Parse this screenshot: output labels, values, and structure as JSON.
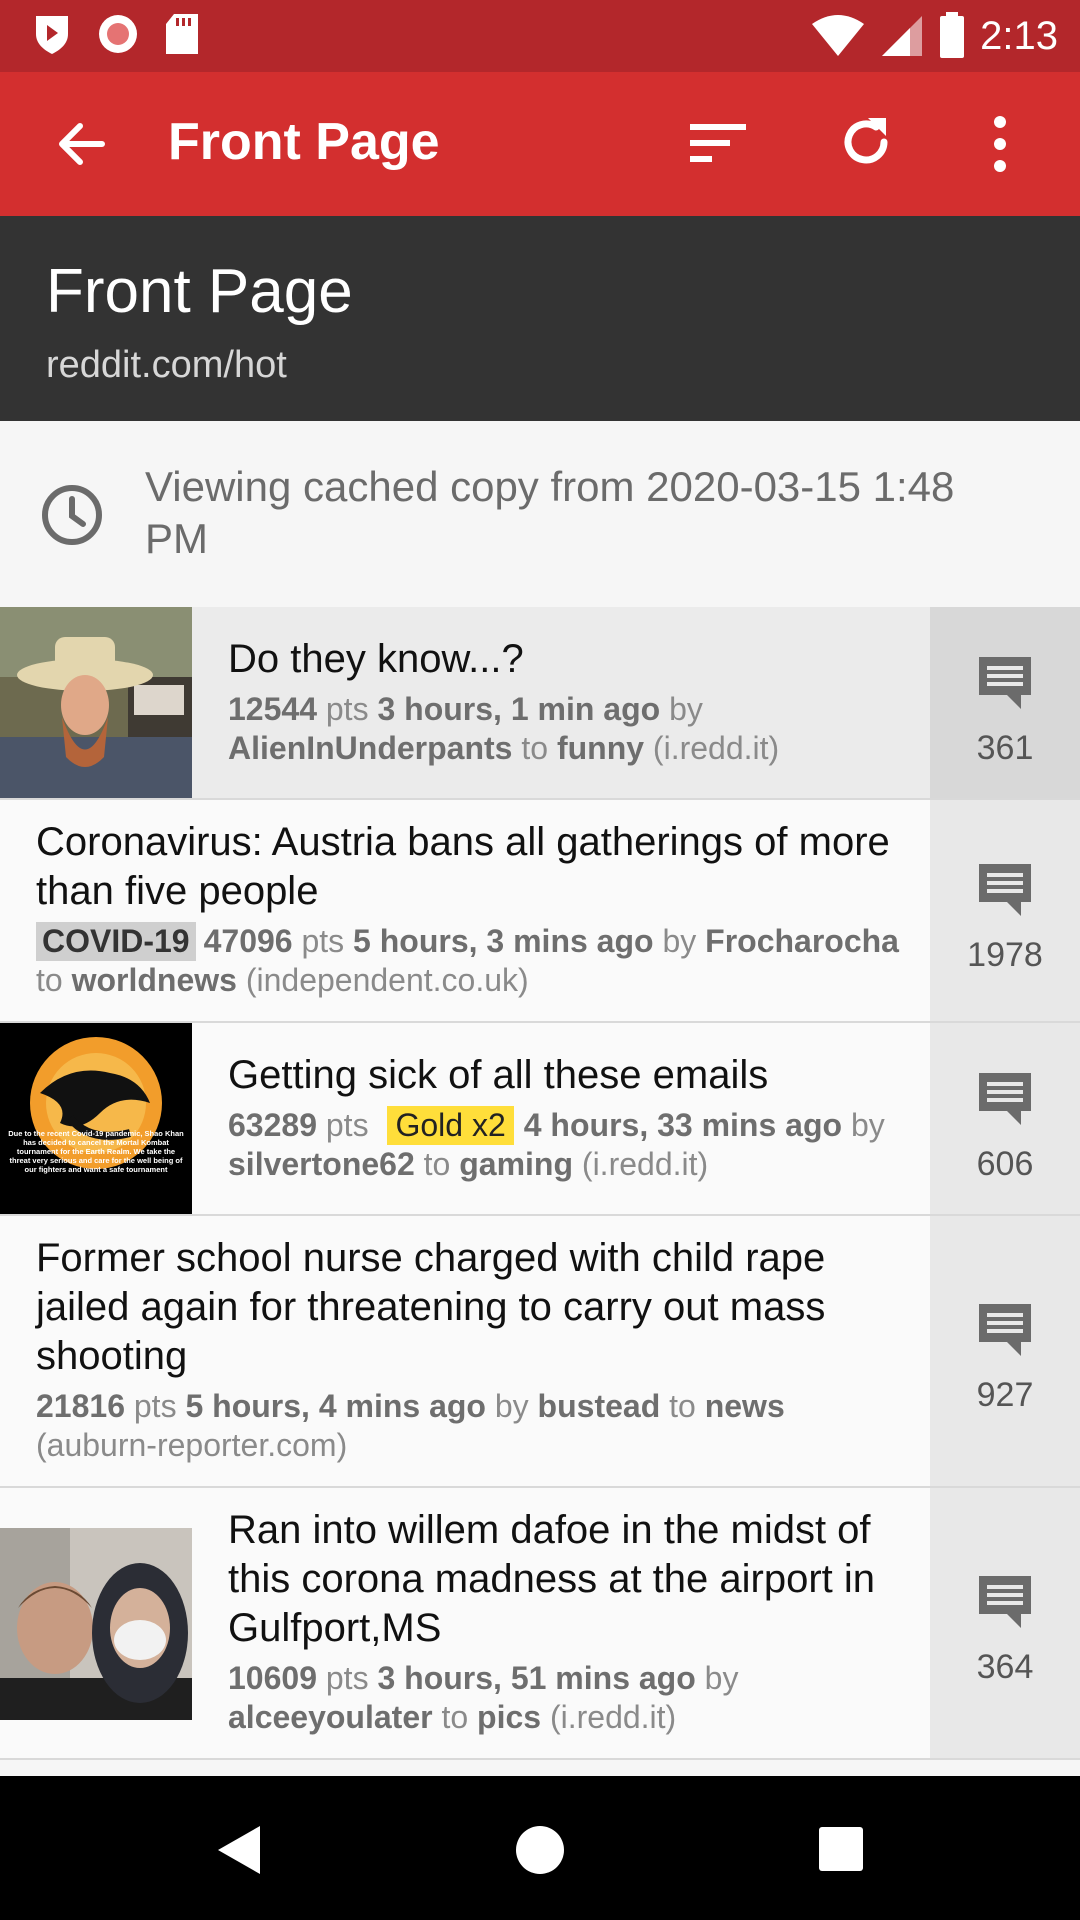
{
  "status": {
    "time": "2:13"
  },
  "toolbar": {
    "title": "Front Page"
  },
  "header": {
    "title": "Front Page",
    "subtitle": "reddit.com/hot"
  },
  "cache_notice": {
    "text": "Viewing cached copy from 2020-03-15 1:48 PM"
  },
  "posts": [
    {
      "title": "Do they know...?",
      "pts": "12544",
      "pts_label": "pts",
      "age": "3 hours, 1 min ago",
      "by": "by",
      "author": "AlienInUnderpants",
      "to": "to",
      "subreddit": "funny",
      "domain": "(i.redd.it)",
      "comments": "361"
    },
    {
      "title": "Coronavirus: Austria bans all gatherings of more than five people",
      "flair": "COVID-19",
      "pts": "47096",
      "pts_label": "pts",
      "age": "5 hours, 3 mins ago",
      "by": "by",
      "author": "Frocharocha",
      "to": "to",
      "subreddit": "worldnews",
      "domain": "(independent.co.uk)",
      "comments": "1978"
    },
    {
      "title": "Getting sick of all these emails",
      "pts": "63289",
      "pts_label": "pts",
      "gold": "Gold x2",
      "age": "4 hours, 33 mins ago",
      "by": "by",
      "author": "silvertone62",
      "to": "to",
      "subreddit": "gaming",
      "domain": "(i.redd.it)",
      "comments": "606",
      "thumb_caption": "Due to the recent Covid-19 pandemic, Shao Khan has decided to cancel the Mortal Kombat tournament for the Earth Realm. We take the threat very serious and care for the well being of our fighters and want a safe tournament"
    },
    {
      "title": "Former school nurse charged with child rape jailed again for threatening to carry out mass shooting",
      "pts": "21816",
      "pts_label": "pts",
      "age": "5 hours, 4 mins ago",
      "by": "by",
      "author": "bustead",
      "to": "to",
      "subreddit": "news",
      "domain": "(auburn-reporter.com)",
      "comments": "927"
    },
    {
      "title": "Ran into willem dafoe in the midst of this corona madness at the airport in Gulfport,MS",
      "pts": "10609",
      "pts_label": "pts",
      "age": "3 hours, 51 mins ago",
      "by": "by",
      "author": "alceeyoulater",
      "to": "to",
      "subreddit": "pics",
      "domain": "(i.redd.it)",
      "comments": "364"
    }
  ],
  "colors": {
    "status_bar": "#b3272b",
    "toolbar": "#d32f2f",
    "header": "#333333",
    "gold": "#ffde3a"
  }
}
